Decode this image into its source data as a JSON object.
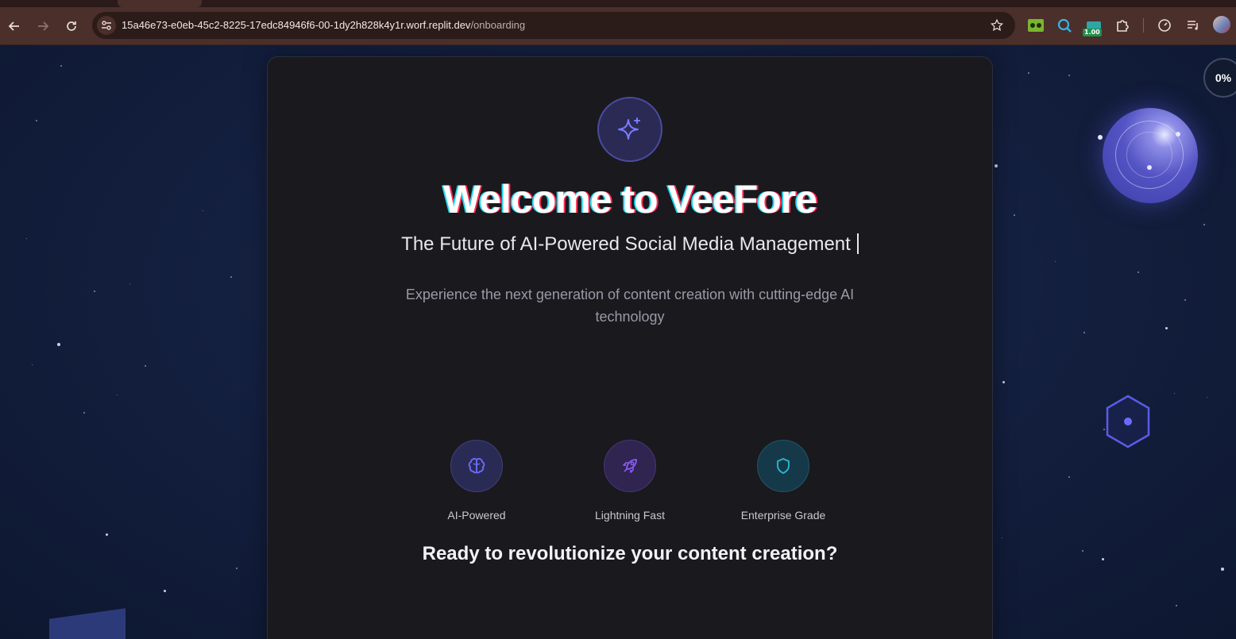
{
  "browser": {
    "url_host": "15a46e73-e0eb-45c2-8225-17edc84946f6-00-1dy2h828k4y1r.worf.replit.dev",
    "url_path": "/onboarding",
    "extension_badge": "1.00"
  },
  "onboarding": {
    "title": "Welcome to VeeFore",
    "subtitle": "The Future of AI-Powered Social Media Management",
    "description": "Experience the next generation of content creation with cutting-edge AI technology",
    "features": [
      {
        "label": "AI-Powered",
        "icon": "brain-icon",
        "color": "#6d6dfa"
      },
      {
        "label": "Lightning Fast",
        "icon": "rocket-icon",
        "color": "#8b5cf6"
      },
      {
        "label": "Enterprise Grade",
        "icon": "shield-icon",
        "color": "#22b8cf"
      }
    ],
    "cta_heading": "Ready to revolutionize your content creation?",
    "progress": "0%"
  },
  "colors": {
    "accent": "#6366f1",
    "card_background": "#1a191d",
    "page_background": "#142040"
  }
}
